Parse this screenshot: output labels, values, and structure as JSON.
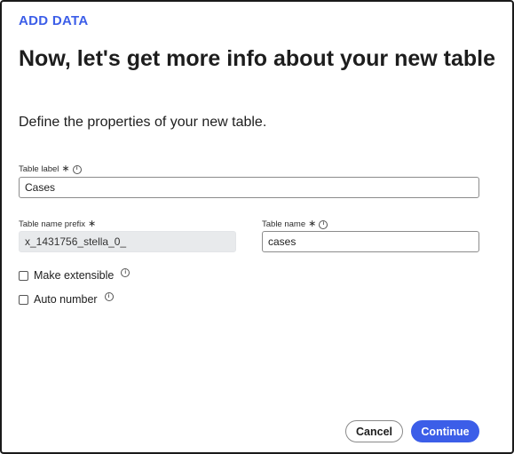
{
  "dialog": {
    "eyebrow": "ADD DATA",
    "title": "Now, let's get more info about your new table",
    "subtitle": "Define the properties of your new table."
  },
  "fields": {
    "table_label": {
      "label": "Table label",
      "value": "Cases"
    },
    "table_name_prefix": {
      "label": "Table name prefix",
      "value": "x_1431756_stella_0_"
    },
    "table_name": {
      "label": "Table name",
      "value": "cases"
    }
  },
  "options": {
    "make_extensible": {
      "label": "Make extensible",
      "checked": false
    },
    "auto_number": {
      "label": "Auto number",
      "checked": false
    }
  },
  "footer": {
    "cancel_label": "Cancel",
    "continue_label": "Continue"
  },
  "icons": {
    "required": "asterisk-icon",
    "info": "info-icon"
  },
  "colors": {
    "accent": "#3c5ee8",
    "text": "#1d1d1d",
    "readonly_bg": "#e8eaec"
  }
}
